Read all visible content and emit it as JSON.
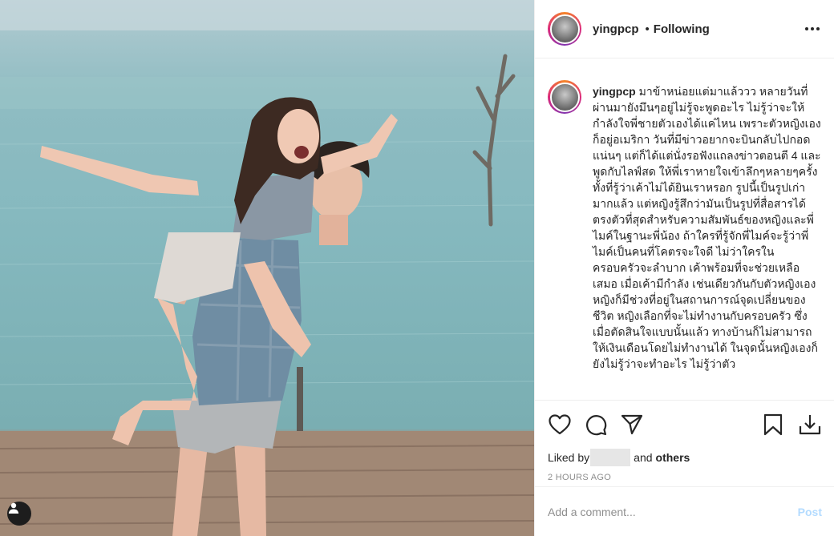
{
  "post": {
    "image_alt": "Photo",
    "username": "yingpcp",
    "separator": "•",
    "follow_status": "Following",
    "caption": "มาข้าหน่อยแต่มาแล้ววว หลายวันที่ผ่านมายังมึนๆอยู่ไม่รู้จะพูดอะไร ไม่รู้ว่าจะให้กำลังใจพี่ชายตัวเองได้แค่ไหน เพราะตัวหญิงเองก็อยู่อเมริกา วันที่มีข่าวอยากจะบินกลับไปกอดแน่นๆ แต่ก็ได้แต่นั่งรอฟังแถลงข่าวตอนตี 4 และพูดกับไลฟ์สด ให้พี่เราหายใจเข้าลึกๆหลายๆครั้งทั้งที่รู้ว่าเค้าไม่ได้ยินเราหรอก รูปนี้เป็นรูปเก่ามากแล้ว แต่หญิงรู้สึกว่ามันเป็นรูปที่สื่อสารได้ตรงตัวที่สุดสำหรับความสัมพันธ์ของหญิงและพี่ไมค์ในฐานะพี่น้อง ถ้าใครที่รู้จักพี่ไมค์จะรู้ว่าพี่ไมค์เป็นคนที่โคตรจะใจดี ไม่ว่าใครในครอบครัวจะลำบาก เค้าพร้อมที่จะช่วยเหลือเสมอ เมื่อเค้ามีกำลัง เช่นเดียวกันกับตัวหญิงเอง หญิงก็มีช่วงที่อยู่ในสถานการณ์จุดเปลี่ยนของชีวิต หญิงเลือกที่จะไม่ทำงานกับครอบครัว ซึ่งเมื่อตัดสินใจแบบนั้นแล้ว ทางบ้านก็ไม่สามารถให้เงินเดือนโดยไม่ทำงานได้ ในจุดนั้นหญิงเองก็ยังไม่รู้ว่าจะทำอะไร ไม่รู้ว่าตัว",
    "liked_by_label": "Liked by",
    "liked_by_suffix_and": "and",
    "liked_by_others": "others",
    "timestamp": "2 HOURS AGO",
    "comment_placeholder": "Add a comment...",
    "post_button": "Post"
  },
  "icons": {
    "like": "heart-icon",
    "comment": "comment-bubble-icon",
    "share": "paper-plane-icon",
    "save": "bookmark-icon",
    "download": "download-icon",
    "more": "more-options-icon",
    "user_tag": "user-tag-icon"
  },
  "colors": {
    "text": "#262626",
    "muted": "#8e8e8e",
    "divider": "#efefef",
    "post_disabled": "#b3dbff"
  }
}
